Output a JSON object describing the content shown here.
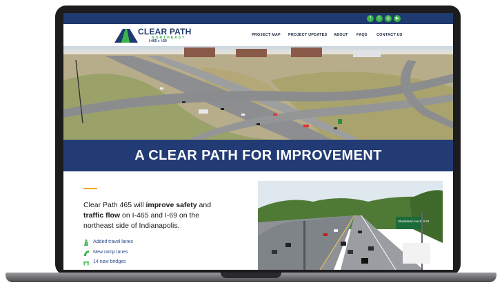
{
  "social": [
    {
      "icon": "facebook-icon",
      "glyph": "f"
    },
    {
      "icon": "twitter-icon",
      "glyph": "t"
    },
    {
      "icon": "instagram-icon",
      "glyph": "◎"
    },
    {
      "icon": "youtube-icon",
      "glyph": "▶"
    }
  ],
  "logo": {
    "title": "CLEAR PATH",
    "subtitle": "NORTHEAST",
    "roads": "I-465 ● I-69"
  },
  "nav": {
    "items": [
      "PROJECT MAP",
      "PROJECT UPDATES",
      "ABOUT",
      "FAQS",
      "CONTACT US"
    ]
  },
  "hero": {
    "heading": "A CLEAR PATH FOR IMPROVEMENT"
  },
  "intro": {
    "text_1": "Clear Path 465 will ",
    "bold_1": "improve safety",
    "text_2": " and ",
    "bold_2": "traffic flow",
    "text_3": " on I-465 and I-69 on the northeast side of Indianapolis."
  },
  "features": [
    {
      "label": "Added travel lanes",
      "icon": "road-icon"
    },
    {
      "label": "New ramp lanes",
      "icon": "ramp-icon"
    },
    {
      "label": "14 new bridges",
      "icon": "bridge-icon"
    }
  ],
  "photo": {
    "sign_text": "Shadeland Ave Exit 40"
  },
  "colors": {
    "navy": "#1f3a6e",
    "banner": "#223b74",
    "green": "#39b54a",
    "accent": "#f2a91f"
  }
}
